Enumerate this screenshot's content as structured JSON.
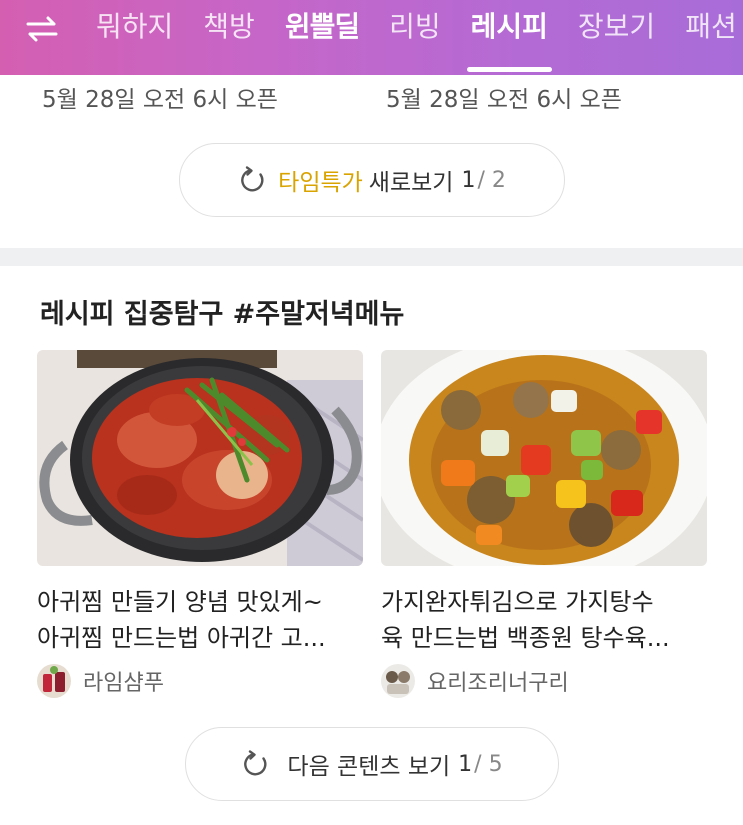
{
  "nav": {
    "swap_icon": "swap-arrows-icon",
    "tabs": [
      "뭐하지",
      "책방",
      "윈쁠딜",
      "리빙",
      "레시피",
      "장보기",
      "패션"
    ],
    "active_index": 4,
    "gradient": [
      "#d45fb1",
      "#a86cd8"
    ]
  },
  "open_times": {
    "left": "5월 28일 오전 6시 오픈",
    "right": "5월 28일 오전 6시 오픈"
  },
  "time_deal_button": {
    "highlight": "타임특가",
    "label": "새로보기",
    "current": "1",
    "total": "/ 2",
    "icon": "refresh-icon",
    "highlight_color": "#d9a300"
  },
  "section": {
    "title": "레시피 집중탐구 #주말저녁메뉴",
    "cards": [
      {
        "title_line1": "아귀찜 만들기 양념 맛있게~",
        "title_line2": "아귀찜 만드는법 아귀간 고...",
        "author": "라임샴푸",
        "image": "braised-monkfish-photo"
      },
      {
        "title_line1": "가지완자튀김으로 가지탕수",
        "title_line2": "육 만드는법 백종원 탕수육...",
        "author": "요리조리너구리",
        "image": "eggplant-sweet-sour-photo"
      }
    ]
  },
  "next_content_button": {
    "label": "다음 콘텐츠 보기",
    "current": "1",
    "total": "/ 5",
    "icon": "refresh-icon"
  }
}
